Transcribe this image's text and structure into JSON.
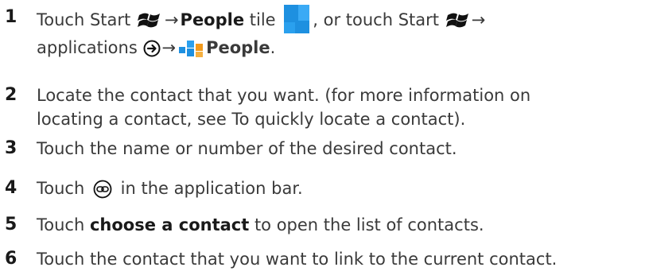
{
  "steps": [
    {
      "num": "1",
      "a": "Touch Start",
      "arrow1": "→",
      "people_bold": "People",
      "b": " tile",
      "c": ", or touch Start",
      "arrow2": "→",
      "d": "applications",
      "arrow3": "→",
      "people_bold2": "People",
      "e": "."
    },
    {
      "num": "2",
      "line1": "Locate the contact that you want. (for more information on",
      "line2": "locating a contact, see To quickly locate a contact)."
    },
    {
      "num": "3",
      "text": "Touch the name or number of the desired contact."
    },
    {
      "num": "4",
      "a": "Touch",
      "b": "in the application bar."
    },
    {
      "num": "5",
      "a": "Touch ",
      "bold": "choose a contact",
      "b": " to open the list of contacts."
    },
    {
      "num": "6",
      "text": "Touch the contact that you want to link to the current contact."
    }
  ],
  "colors": {
    "tile_blue": "#1e90e0",
    "tile_orange": "#f29a1c",
    "text": "#3a3a3a",
    "number": "#1a1a1a"
  },
  "icons": [
    "windows-start-icon",
    "people-tile-icon",
    "applications-arrow-icon",
    "link-icon"
  ]
}
